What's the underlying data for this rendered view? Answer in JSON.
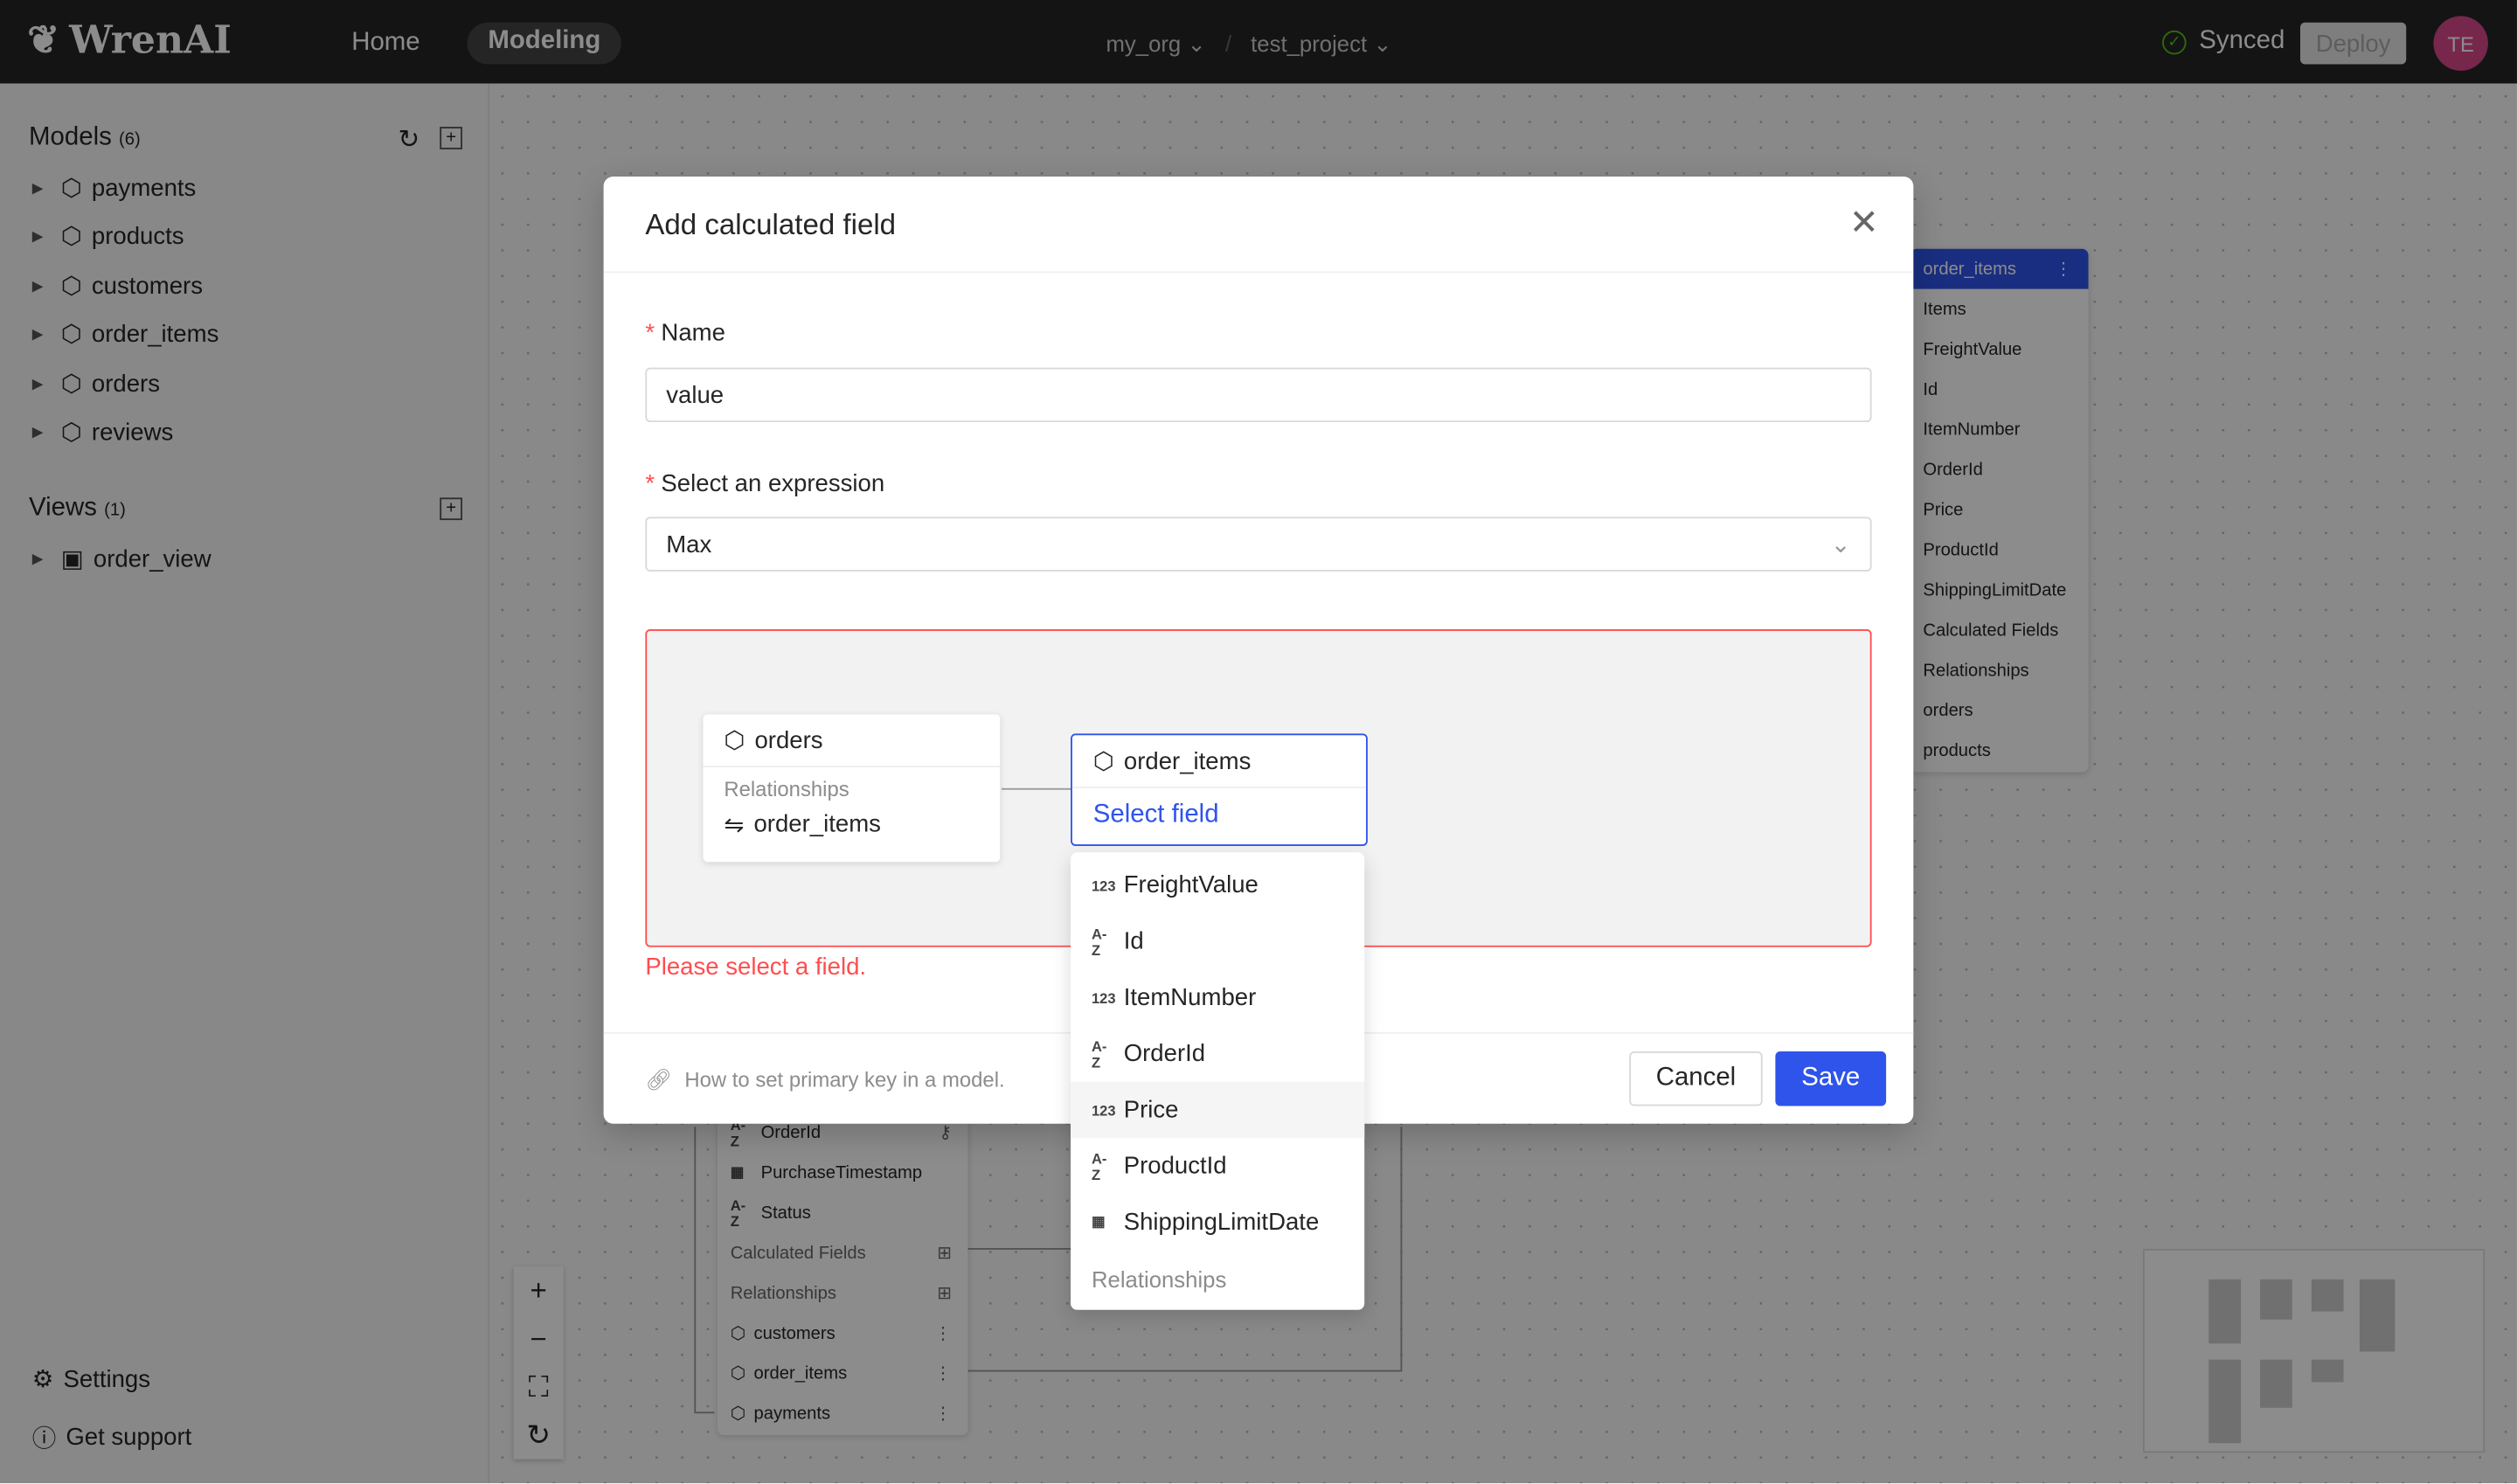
{
  "header": {
    "brand": "WrenAI",
    "nav": [
      "Home",
      "Modeling"
    ],
    "active_nav": "Modeling",
    "org": "my_org",
    "project": "test_project",
    "sync_status": "Synced",
    "deploy_label": "Deploy",
    "avatar_initials": "TE"
  },
  "sidebar": {
    "models_title": "Models",
    "models_count": "(6)",
    "models": [
      "payments",
      "products",
      "customers",
      "order_items",
      "orders",
      "reviews"
    ],
    "views_title": "Views",
    "views_count": "(1)",
    "views": [
      "order_view"
    ],
    "settings": "Settings",
    "support": "Get support"
  },
  "canvas": {
    "right_node": {
      "title": "order_items",
      "rows": [
        "Items",
        "FreightValue",
        "Id",
        "ItemNumber",
        "OrderId",
        "Price",
        "ProductId",
        "ShippingLimitDate",
        "Calculated Fields",
        "Relationships",
        "orders",
        "products"
      ]
    },
    "bottom_node": {
      "rows": [
        {
          "type": "A-Z",
          "label": "OrderId"
        },
        {
          "type": "date",
          "label": "PurchaseTimestamp"
        },
        {
          "type": "A-Z",
          "label": "Status"
        }
      ],
      "calc": "Calculated Fields",
      "rel": "Relationships",
      "relations": [
        "customers",
        "order_items",
        "payments"
      ]
    }
  },
  "modal": {
    "title": "Add calculated field",
    "name_label": "Name",
    "name_value": "value",
    "expression_label": "Select an expression",
    "expression_value": "Max",
    "source_model": "orders",
    "relationships_label": "Relationships",
    "relationship_item": "order_items",
    "target_model": "order_items",
    "select_field_placeholder": "Select field",
    "error": "Please select a field.",
    "help_link": "How to set primary key in a model.",
    "cancel": "Cancel",
    "save": "Save",
    "field_options": [
      {
        "type": "123",
        "label": "FreightValue"
      },
      {
        "type": "A-Z",
        "label": "Id"
      },
      {
        "type": "123",
        "label": "ItemNumber"
      },
      {
        "type": "A-Z",
        "label": "OrderId"
      },
      {
        "type": "123",
        "label": "Price",
        "hovered": true
      },
      {
        "type": "A-Z",
        "label": "ProductId"
      },
      {
        "type": "date",
        "label": "ShippingLimitDate"
      }
    ],
    "options_relationships_label": "Relationships"
  },
  "colors": {
    "primary": "#2f54eb",
    "error": "#ff4d4f",
    "header_bg": "#262626",
    "synced": "#52c41a"
  }
}
